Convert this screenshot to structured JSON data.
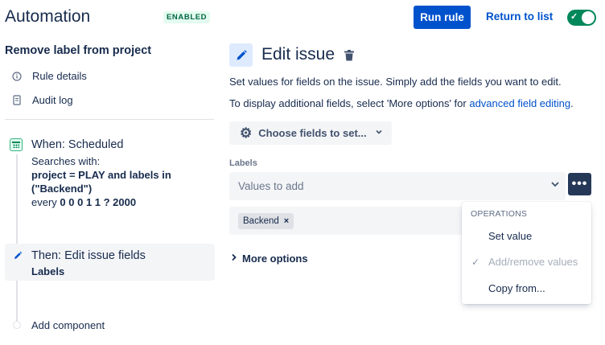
{
  "header": {
    "title": "Automation",
    "status_badge": "ENABLED",
    "run_rule_label": "Run rule",
    "return_link": "Return to list",
    "toggle_on": true
  },
  "sidebar": {
    "rule_name": "Remove label from project",
    "links": [
      {
        "label": "Rule details",
        "icon": "info-icon"
      },
      {
        "label": "Audit log",
        "icon": "document-icon"
      }
    ],
    "trigger": {
      "title": "When: Scheduled",
      "searches_with": "Searches with:",
      "query": "project = PLAY and labels in (\"Backend\")",
      "every_prefix": "every",
      "schedule": "0 0 0 1 1 ? 2000"
    },
    "action": {
      "title": "Then: Edit issue fields",
      "subtitle": "Labels"
    },
    "add_component": "Add component"
  },
  "main": {
    "title": "Edit issue",
    "description": "Set values for fields on the issue. Simply add the fields you want to edit.",
    "more_info_prefix": "To display additional fields, select 'More options' for ",
    "more_info_link": "advanced field editing",
    "more_info_suffix": ".",
    "choose_fields_label": "Choose fields to set...",
    "labels_field_label": "Labels",
    "values_placeholder": "Values to add",
    "chips": [
      "Backend"
    ],
    "more_options_label": "More options"
  },
  "operations_menu": {
    "header": "OPERATIONS",
    "items": [
      {
        "label": "Set value",
        "selected": false,
        "disabled": false
      },
      {
        "label": "Add/remove values",
        "selected": true,
        "disabled": true
      },
      {
        "label": "Copy from...",
        "selected": false,
        "disabled": false
      }
    ]
  },
  "colors": {
    "primary": "#0052cc",
    "success": "#00875a",
    "text": "#172b4d",
    "subtle_bg": "#f4f5f7",
    "dark_button": "#253858"
  }
}
